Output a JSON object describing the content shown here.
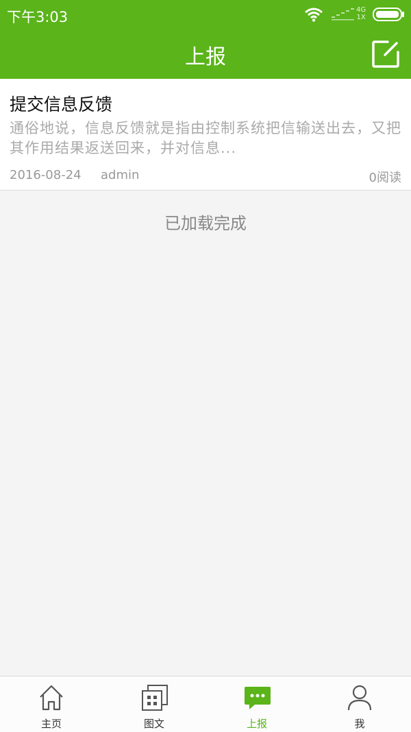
{
  "status_bar": {
    "time": "下午3:03",
    "network": "4G",
    "network_sub": "1X"
  },
  "header": {
    "title": "上报",
    "action_icon": "edit-icon"
  },
  "post": {
    "title": "提交信息反馈",
    "summary": "通俗地说，信息反馈就是指由控制系统把信输送出去，又把其作用结果返送回来，并对信息...",
    "date": "2016-08-24",
    "author": "admin",
    "reads": "0阅读"
  },
  "list_footer": "已加载完成",
  "tabs": [
    {
      "label": "主页",
      "icon": "home-icon",
      "active": false
    },
    {
      "label": "图文",
      "icon": "grid-icon",
      "active": false
    },
    {
      "label": "上报",
      "icon": "chat-icon",
      "active": true
    },
    {
      "label": "我",
      "icon": "user-icon",
      "active": false
    }
  ],
  "colors": {
    "brand": "#5ab41a",
    "background": "#f4f4f4",
    "muted_text": "#aaaaaa"
  }
}
